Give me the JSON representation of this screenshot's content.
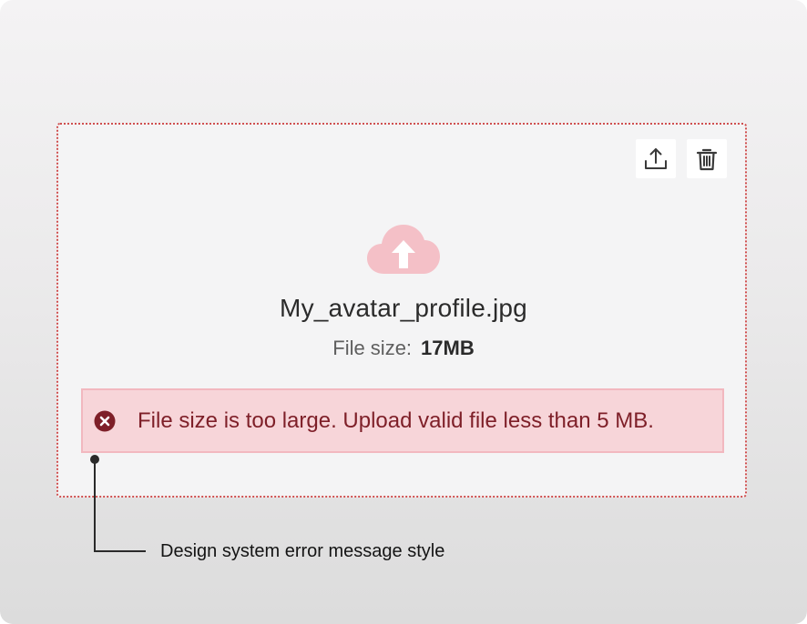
{
  "upload": {
    "file_name": "My_avatar_profile.jpg",
    "file_size_label": "File size:",
    "file_size_value": "17MB"
  },
  "error": {
    "message": "File size is too large. Upload valid file less than 5 MB."
  },
  "annotation": {
    "label": "Design system error message style"
  },
  "colors": {
    "dropzone_border": "#cf4f4f",
    "error_background": "#f7d5d9",
    "error_text": "#7e1f28",
    "cloud_icon": "#f4c0c7"
  },
  "icons": {
    "upload": "upload-icon",
    "delete": "trash-icon",
    "cloud": "cloud-upload-icon",
    "error": "error-circle-x-icon"
  }
}
